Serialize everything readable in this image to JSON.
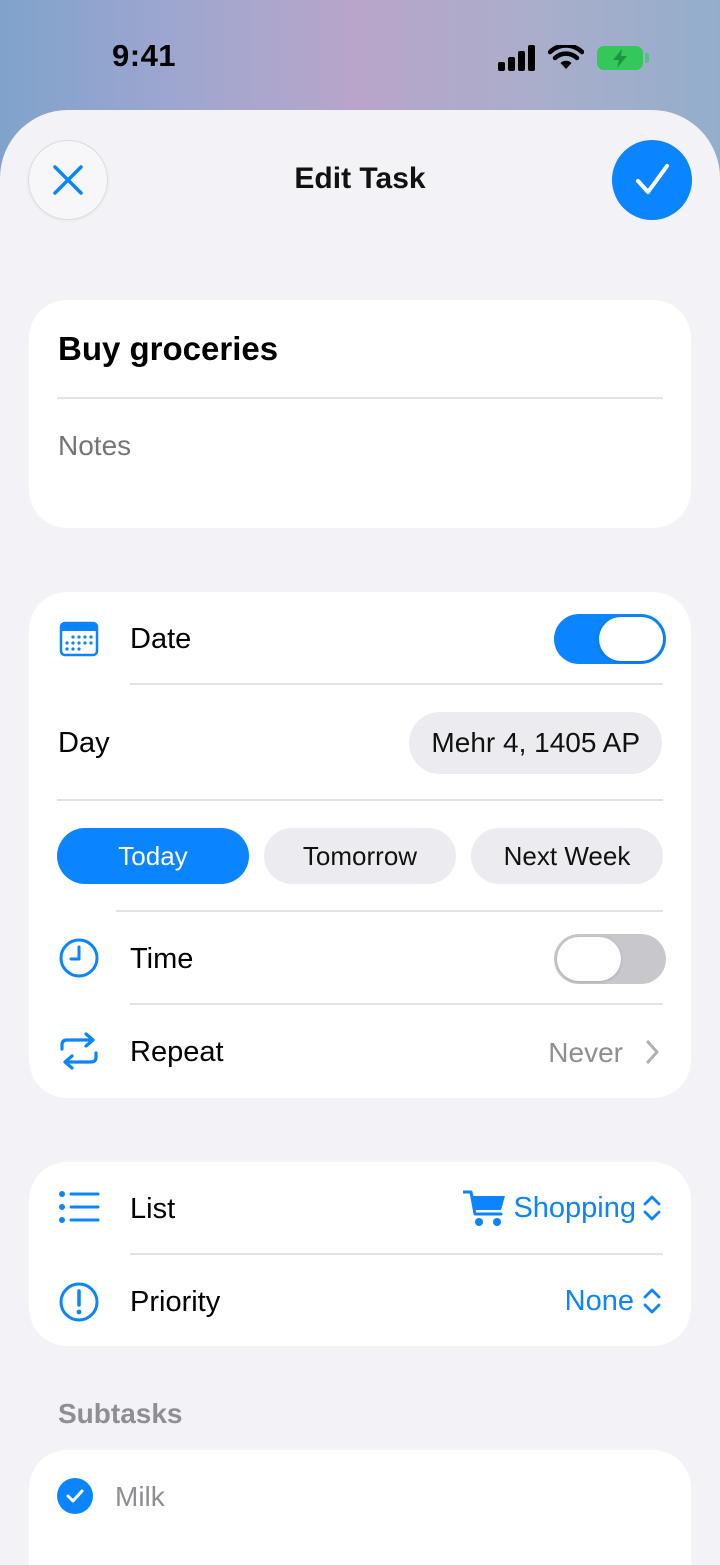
{
  "status_bar": {
    "time": "9:41",
    "icons": [
      "signal-icon",
      "wifi-icon",
      "battery-charging-icon"
    ],
    "battery_color": "#34c759"
  },
  "nav": {
    "title": "Edit Task",
    "close_icon": "close-icon",
    "confirm_icon": "checkmark-icon"
  },
  "task": {
    "title": "Buy groceries",
    "notes_placeholder": "Notes",
    "notes_value": ""
  },
  "date_section": {
    "date_label": "Date",
    "date_icon": "calendar-icon",
    "date_enabled": true,
    "day_label": "Day",
    "day_value": "Mehr 4, 1405 AP",
    "quick_options": [
      {
        "label": "Today",
        "selected": true
      },
      {
        "label": "Tomorrow",
        "selected": false
      },
      {
        "label": "Next Week",
        "selected": false
      }
    ],
    "time_label": "Time",
    "time_icon": "clock-icon",
    "time_enabled": false,
    "repeat_label": "Repeat",
    "repeat_icon": "repeat-icon",
    "repeat_value": "Never"
  },
  "list_section": {
    "list_label": "List",
    "list_icon": "list-icon",
    "list_value": "Shopping",
    "list_value_icon": "cart-icon",
    "priority_label": "Priority",
    "priority_icon": "exclamation-circle-icon",
    "priority_value": "None"
  },
  "subtasks": {
    "header": "Subtasks",
    "items": [
      {
        "label": "Milk",
        "completed": true
      }
    ]
  },
  "colors": {
    "accent": "#0a84ff",
    "background": "#f2f2f7",
    "card": "#ffffff",
    "secondary_text": "#8e8e93"
  }
}
